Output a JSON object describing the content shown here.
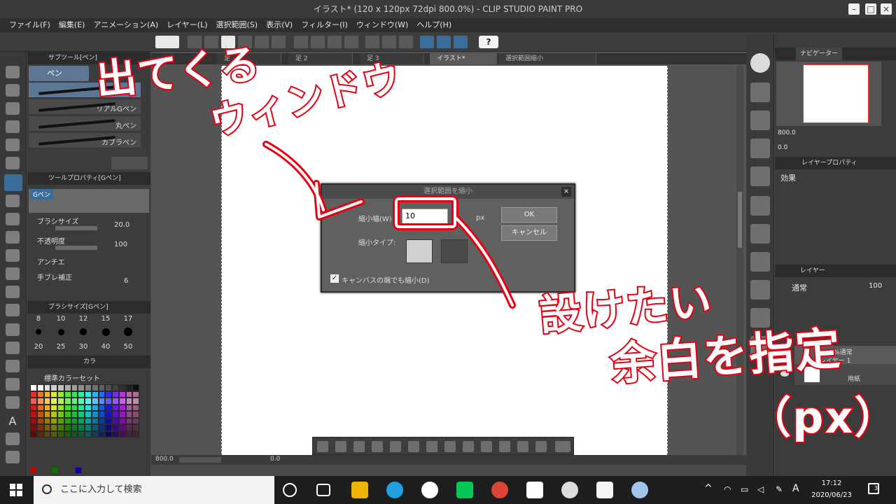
{
  "window": {
    "title": "イラスト* (120 x 120px 72dpi 800.0%) - CLIP STUDIO PAINT PRO"
  },
  "menu": [
    "ファイル(F)",
    "編集(E)",
    "アニメーション(A)",
    "レイヤー(L)",
    "選択範囲(S)",
    "表示(V)",
    "フィルター(I)",
    "ウィンドウ(W)",
    "ヘルプ(H)"
  ],
  "left_panel": {
    "subtool_header": "サブツール[ペン]",
    "active_subtool": "ペン",
    "brushes": [
      "リアルGペン",
      "丸ペン",
      "カブラペン"
    ],
    "toolprop_header": "ツールプロパティ[Gペン]",
    "preview_label": "Gペン",
    "props": [
      {
        "label": "ブラシサイズ",
        "value": "20.0"
      },
      {
        "label": "不透明度",
        "value": "100"
      },
      {
        "label": "アンチエ",
        "value": ""
      },
      {
        "label": "手ブレ補正",
        "value": "6"
      }
    ],
    "brushsize_header": "ブラシサイズ[Gペン]",
    "sizes_top": [
      "8",
      "10",
      "12",
      "15",
      "17"
    ],
    "sizes_bottom": [
      "20",
      "25",
      "30",
      "40",
      "50"
    ],
    "color_tab": "カラ",
    "colorset": "標準カラーセット"
  },
  "doc_tabs": [
    "足",
    "足 2",
    "足 3",
    "イラスト*",
    "選択範囲縮小"
  ],
  "status": {
    "zoom": "800.0",
    "angle": "0.0"
  },
  "dialog": {
    "title": "選択範囲を縮小",
    "width_label": "縮小幅(W):",
    "width_value": "10",
    "unit": "px",
    "type_label": "縮小タイプ:",
    "ok": "OK",
    "cancel": "キャンセル",
    "checkbox_label": "キャンバスの端でも縮小(D)",
    "checkbox_checked": true
  },
  "right_panel": {
    "navigator_tab": "ナビゲーター",
    "nav_zoom": "800.0",
    "nav_angle": "0.0",
    "layerprop_tab": "レイヤープロパティ",
    "effect_label": "効果",
    "layer_tab": "レイヤー",
    "blend_mode": "通常",
    "opacity": "100",
    "layers": [
      {
        "mode": "100 %通常",
        "name": "レイヤー 1"
      },
      {
        "mode": "",
        "name": "用紙"
      }
    ]
  },
  "taskbar": {
    "search_placeholder": "ここに入力して検索",
    "time": "17:12",
    "date": "2020/06/23",
    "ime": "A",
    "notifications": "3"
  },
  "annotations": {
    "appear_line1": "出てくる",
    "appear_line2": "ウィンドウ",
    "specify_line1": "設けたい",
    "specify_line2": "余白を指定",
    "specify_line3": "（px）"
  },
  "colors": {
    "annotation_red": "#e60012",
    "accent_blue": "#3a6d9a",
    "panel_dark": "#3c3c3c"
  }
}
